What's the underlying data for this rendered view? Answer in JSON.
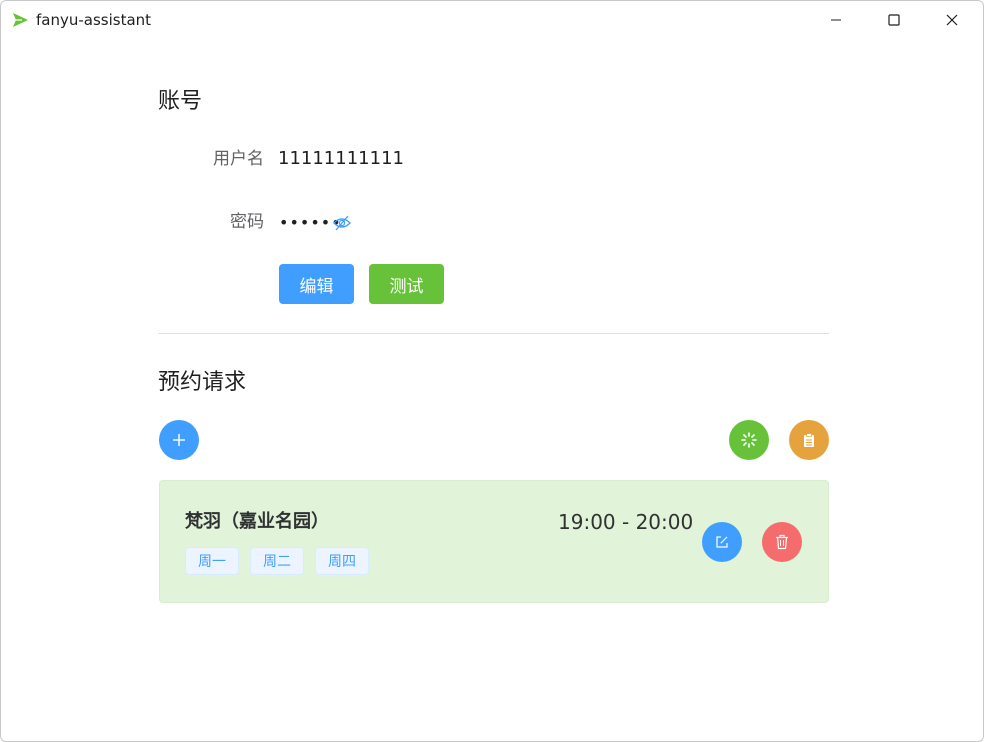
{
  "window": {
    "title": "fanyu-assistant"
  },
  "icons": {
    "logo": "send-arrow-icon",
    "minimize": "minimize-icon",
    "maximize": "maximize-icon",
    "close": "close-icon"
  },
  "account": {
    "title": "账号",
    "username_label": "用户名",
    "username_value": "11111111111",
    "password_label": "密码",
    "password_value": "••••••",
    "edit_label": "编辑",
    "test_label": "测试"
  },
  "booking": {
    "title": "预约请求",
    "requests": [
      {
        "name": "梵羽（嘉业名园）",
        "time": "19:00 - 20:00",
        "days": [
          "周一",
          "周二",
          "周四"
        ]
      }
    ]
  },
  "colors": {
    "primary": "#409eff",
    "success": "#67c23a",
    "warning": "#e6a23c",
    "danger": "#f56c6c",
    "card_bg": "#e1f3d8"
  }
}
